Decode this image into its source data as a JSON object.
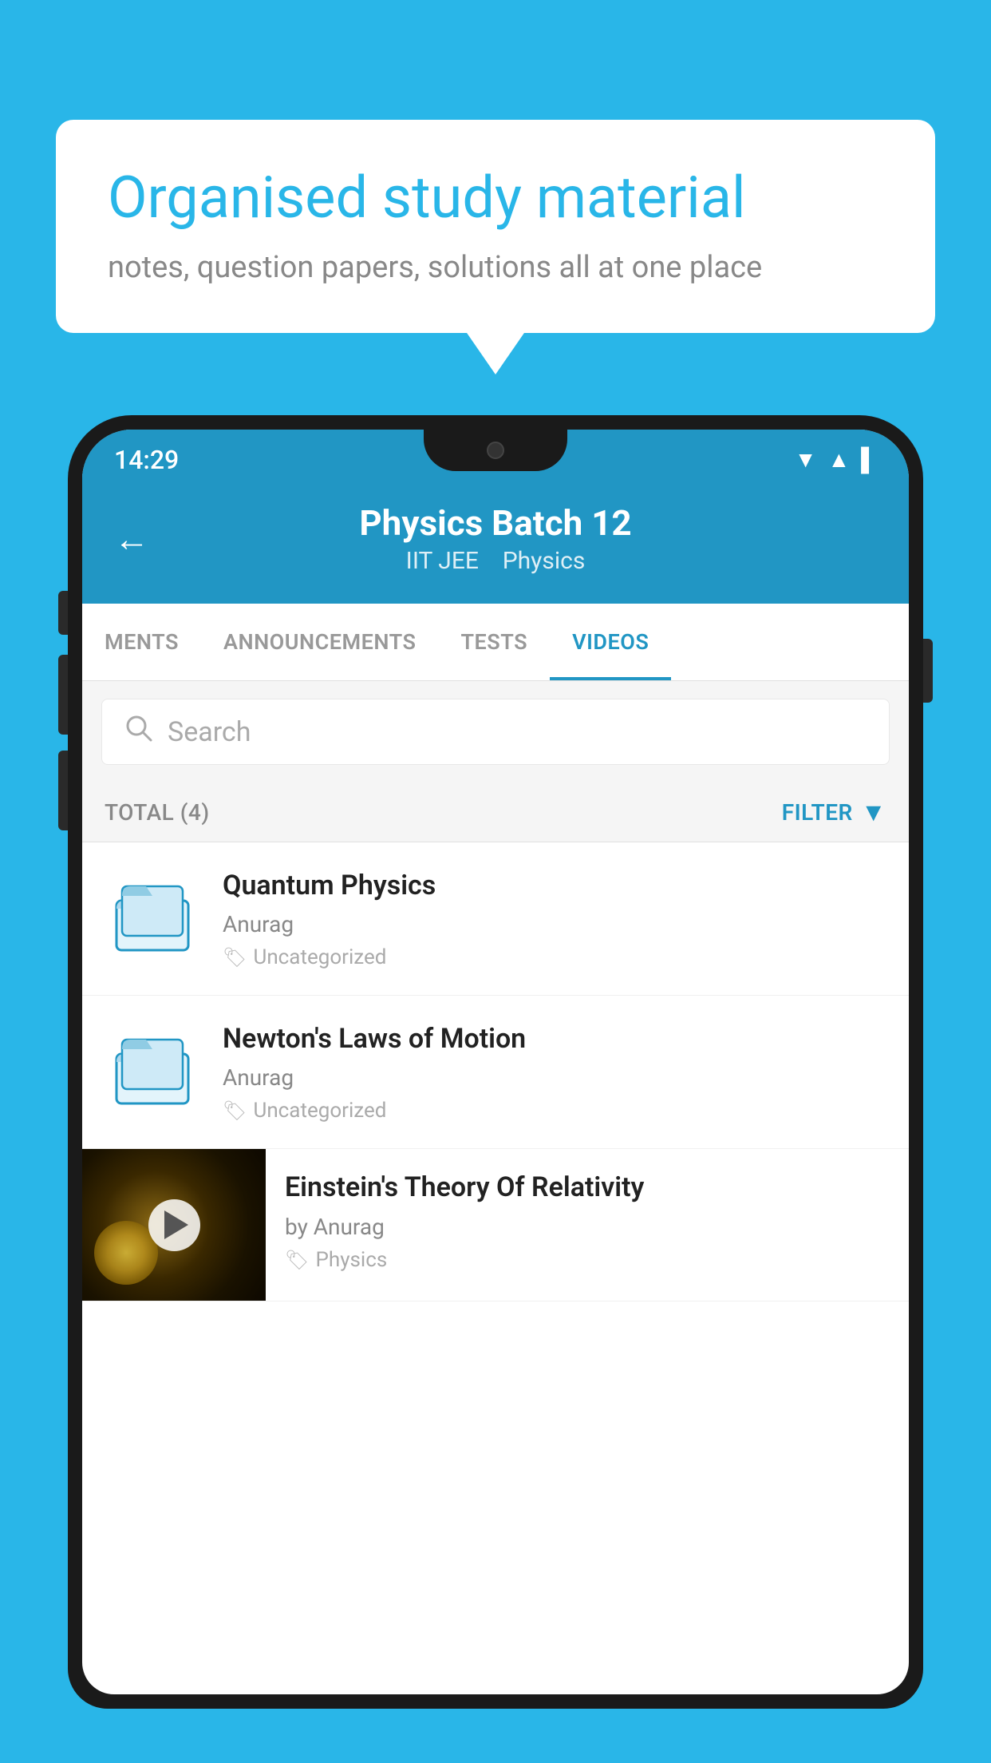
{
  "background_color": "#29b6e8",
  "bubble": {
    "title": "Organised study material",
    "subtitle": "notes, question papers, solutions all at one place"
  },
  "phone": {
    "status_bar": {
      "time": "14:29",
      "wifi": "▼",
      "signal": "▲",
      "battery": "▌"
    },
    "header": {
      "back_label": "←",
      "title": "Physics Batch 12",
      "subtitle_1": "IIT JEE",
      "subtitle_2": "Physics"
    },
    "tabs": [
      {
        "label": "MENTS",
        "active": false
      },
      {
        "label": "ANNOUNCEMENTS",
        "active": false
      },
      {
        "label": "TESTS",
        "active": false
      },
      {
        "label": "VIDEOS",
        "active": true
      }
    ],
    "search": {
      "placeholder": "Search"
    },
    "filter": {
      "total_label": "TOTAL (4)",
      "filter_label": "FILTER"
    },
    "videos": [
      {
        "id": "v1",
        "title": "Quantum Physics",
        "author": "Anurag",
        "tag": "Uncategorized",
        "type": "folder"
      },
      {
        "id": "v2",
        "title": "Newton's Laws of Motion",
        "author": "Anurag",
        "tag": "Uncategorized",
        "type": "folder"
      },
      {
        "id": "v3",
        "title": "Einstein's Theory Of Relativity",
        "author": "by Anurag",
        "tag": "Physics",
        "type": "video"
      }
    ]
  }
}
